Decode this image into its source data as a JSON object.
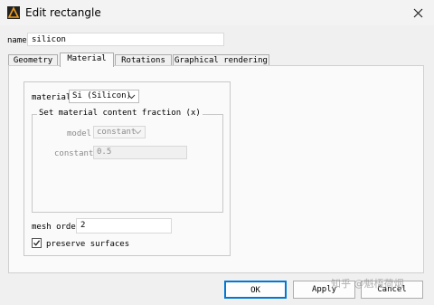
{
  "window": {
    "title": "Edit rectangle"
  },
  "name_field": {
    "label": "name",
    "value": "silicon"
  },
  "tabs": [
    {
      "label": "Geometry"
    },
    {
      "label": "Material"
    },
    {
      "label": "Rotations"
    },
    {
      "label": "Graphical rendering"
    }
  ],
  "material": {
    "label": "material",
    "selected": "Si (Silicon)",
    "fraction_group": {
      "legend": "Set material content fraction (x)",
      "model_label": "model",
      "model_value": "constant",
      "constant_label": "constant",
      "constant_value": "0.5"
    }
  },
  "mesh_order": {
    "label": "mesh order",
    "value": "2"
  },
  "preserve_surfaces": {
    "label": "preserve surfaces",
    "checked": true
  },
  "buttons": {
    "ok": "OK",
    "apply": "Apply",
    "cancel": "Cancel"
  },
  "watermark": "知乎 @魁梧荷烟",
  "colors": {
    "focus_border": "#0078d4",
    "window_bg": "#f0f0f0",
    "panel_bg": "#fafafa"
  }
}
